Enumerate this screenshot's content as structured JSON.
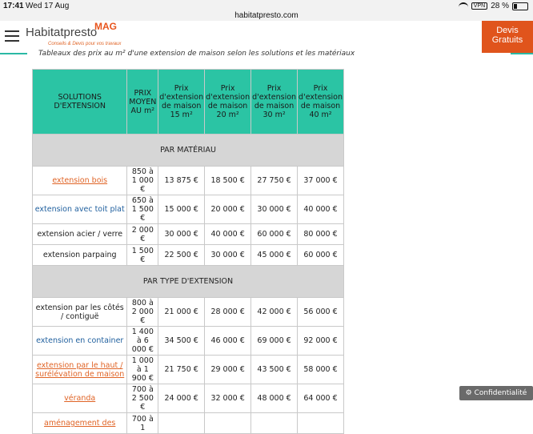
{
  "status": {
    "time": "17:41",
    "date": "Wed 17 Aug",
    "url": "habitatpresto.com",
    "vpn": "VPN",
    "battery": "28 %"
  },
  "header": {
    "logo_main": "Habitatpresto",
    "logo_mag": "MAG",
    "tagline": "Conseils & Devis pour vos travaux",
    "devis_line1": "Devis",
    "devis_line2": "Gratuits"
  },
  "caption": "Tableaux des prix au m² d'une extension de maison selon les solutions et les matériaux",
  "table": {
    "headers": [
      "SOLUTIONS D'EXTENSION",
      "PRIX MOYEN AU m²",
      "Prix d'extension de maison 15 m²",
      "Prix d'extension de maison 20 m²",
      "Prix d'extension de maison 30 m²",
      "Prix d'extension de maison 40 m²"
    ],
    "section1": "PAR MATÉRIAU",
    "section2": "PAR TYPE D'EXTENSION",
    "rows1": [
      [
        "extension bois",
        "850 à 1 000 €",
        "13 875 €",
        "18 500 €",
        "27 750 €",
        "37 000 €"
      ],
      [
        "extension avec toit plat",
        "650 à 1 500 €",
        "15 000 €",
        "20 000 €",
        "30 000 €",
        "40 000 €"
      ],
      [
        "extension acier / verre",
        "2 000 €",
        "30 000 €",
        "40 000 €",
        "60 000 €",
        "80 000 €"
      ],
      [
        "extension parpaing",
        "1 500 €",
        "22 500 €",
        "30 000 €",
        "45 000 €",
        "60 000 €"
      ]
    ],
    "rows2": [
      [
        "extension par les côtés / contiguë",
        "800 à 2 000 €",
        "21 000 €",
        "28 000 €",
        "42 000 €",
        "56 000 €"
      ],
      [
        "extension en container",
        "1 400 à 6 000 €",
        "34 500 €",
        "46 000 €",
        "69 000 €",
        "92 000 €"
      ],
      [
        "extension par le haut / surélévation de maison",
        "1 000 à 1 900 €",
        "21 750 €",
        "29 000 €",
        "43 500 €",
        "58 000 €"
      ],
      [
        "véranda",
        "700 à 2 500 €",
        "24 000 €",
        "32 000 €",
        "48 000 €",
        "64 000 €"
      ],
      [
        "aménagement des",
        "700 à 1",
        "",
        "",
        "",
        ""
      ]
    ]
  },
  "cookie": "Confidentialité"
}
